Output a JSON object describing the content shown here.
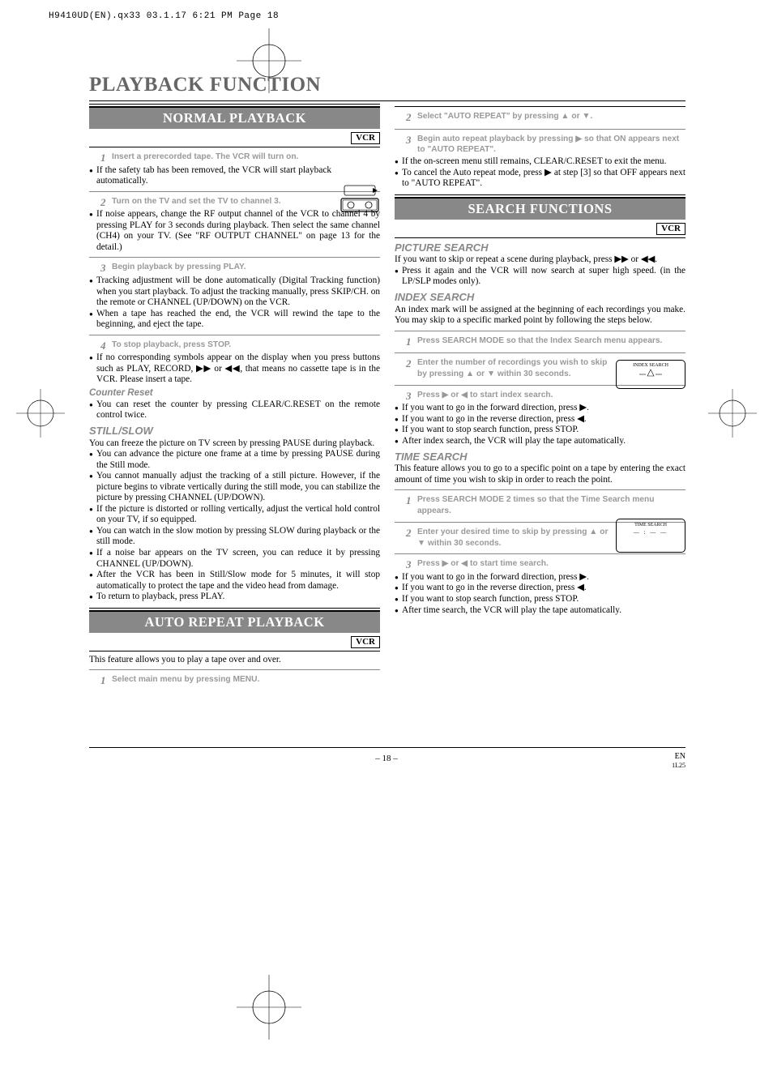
{
  "header_line": "H9410UD(EN).qx33  03.1.17 6:21 PM  Page 18",
  "page_title": "PLAYBACK FUNCTION",
  "vcr_tag": "VCR",
  "left": {
    "section1": "NORMAL PLAYBACK",
    "s1_step1": "Insert a prerecorded tape. The VCR will turn on.",
    "s1_b1": "If the safety tab has been removed, the VCR will start playback automatically.",
    "s1_step2": "Turn on the TV and set the TV to channel 3.",
    "s1_b2": "If noise appears, change the RF output channel of the VCR to channel 4 by pressing PLAY for 3 seconds during playback.  Then select the same channel (CH4) on your TV. (See \"RF OUTPUT CHANNEL\" on page 13 for the detail.)",
    "s1_step3": "Begin playback by pressing PLAY.",
    "s1_b3a": "Tracking adjustment will be done automatically (Digital Tracking function) when you start playback. To adjust the tracking manually, press SKIP/CH. on the remote or CHANNEL (UP/DOWN) on the VCR.",
    "s1_b3b": "When a tape has reached the end, the VCR will rewind the tape to the beginning, and eject the tape.",
    "s1_step4": "To stop playback, press STOP.",
    "s1_b4_pre": "If no corresponding symbols appear on the display when you press buttons such as PLAY, RECORD, ",
    "s1_b4_post": ", that means no cassette tape is in the VCR. Please insert a tape.",
    "counter_head": "Counter Reset",
    "counter_b1": "You can reset the counter by pressing CLEAR/C.RESET on the remote control twice.",
    "still_head": "STILL/SLOW",
    "still_intro": "You can freeze the picture on TV screen by pressing PAUSE during playback.",
    "still_b1": "You can advance the picture one frame at a time by pressing PAUSE during the Still mode.",
    "still_b2": "You cannot manually adjust the tracking of a still picture. However, if the picture begins to vibrate vertically during the still mode, you can stabilize the picture by pressing CHANNEL (UP/DOWN).",
    "still_b3": "If the picture is distorted or rolling vertically, adjust the vertical hold control on your TV, if so equipped.",
    "still_b4": "You can watch in the slow motion by pressing SLOW during playback or the still mode.",
    "still_b5": "If a noise bar appears on the TV screen, you can reduce it by pressing CHANNEL (UP/DOWN).",
    "still_b6": "After the VCR has been in Still/Slow mode for 5 minutes, it will stop automatically to protect the tape and the video head from damage.",
    "still_b7": "To return to playback, press PLAY.",
    "section2": "AUTO REPEAT PLAYBACK",
    "s2_intro": "This feature allows you to play a tape over and over.",
    "s2_step1": "Select main menu by pressing MENU."
  },
  "right": {
    "s2_step2_pre": "Select \"AUTO REPEAT\" by pressing ",
    "s2_step2_mid": " or ",
    "s2_step2_post": ".",
    "s2_step3_pre": "Begin auto repeat playback by pressing ",
    "s2_step3_post": " so that ON appears next to \"AUTO REPEAT\".",
    "s2_b1": "If the on-screen menu still remains, CLEAR/C.RESET to exit the menu.",
    "s2_b2_pre": "To cancel the Auto repeat mode, press ",
    "s2_b2_post": " at step [3] so that OFF appears next to \"AUTO REPEAT\".",
    "section3": "SEARCH FUNCTIONS",
    "ps_head": "PICTURE SEARCH",
    "ps_intro_pre": "If you want to skip or repeat a scene during playback, press ",
    "ps_intro_mid": " or ",
    "ps_intro_post": ".",
    "ps_b1": "Press it again and the VCR will now search at super high speed. (in the LP/SLP modes only).",
    "is_head": "INDEX SEARCH",
    "is_intro": "An index mark will be assigned at the beginning of each recordings you make. You may skip to a specific marked point by following the steps below.",
    "is_step1": "Press SEARCH MODE so that the Index Search menu appears.",
    "is_step2_pre": "Enter the number of recordings you wish to skip by pressing ",
    "is_step2_mid": " or ",
    "is_step2_post": " within 30 seconds.",
    "is_diag_title": "INDEX SEARCH",
    "is_step3_pre": "Press ",
    "is_step3_mid": " or ",
    "is_step3_post": " to start index search.",
    "is_b1_pre": "If you want to go in the forward direction, press ",
    "is_b1_post": ".",
    "is_b2_pre": "If you want to go in the reverse direction, press ",
    "is_b2_post": ".",
    "is_b3": "If you want to stop search function, press STOP.",
    "is_b4": "After index search, the VCR will play the tape automatically.",
    "ts_head": "TIME SEARCH",
    "ts_intro": "This feature allows you to go to a specific point on a tape by entering the exact amount of time you wish to skip in order to reach the point.",
    "ts_step1": "Press SEARCH MODE 2 times so that the Time Search menu appears.",
    "ts_step2_pre": "Enter your desired time to skip by pressing ",
    "ts_step2_mid": " or ",
    "ts_step2_post": " within 30 seconds.",
    "ts_diag_title": "TIME SEARCH",
    "ts_diag_val": "— : — —",
    "ts_step3_pre": "Press ",
    "ts_step3_mid": " or ",
    "ts_step3_post": " to start time search.",
    "ts_b1_pre": "If you want to go in the forward direction, press ",
    "ts_b1_post": ".",
    "ts_b2_pre": "If you want to go in the reverse direction, press ",
    "ts_b2_post": ".",
    "ts_b3": "If you want to stop search function, press STOP.",
    "ts_b4": "After time search, the VCR will play the tape automatically."
  },
  "footer": {
    "page": "– 18 –",
    "en": "EN",
    "code": "1L25"
  },
  "glyphs": {
    "up": "▲",
    "down": "▼",
    "play": "▶",
    "ffwd": "▶▶",
    "rew": "◀◀",
    "rev": "◀"
  }
}
